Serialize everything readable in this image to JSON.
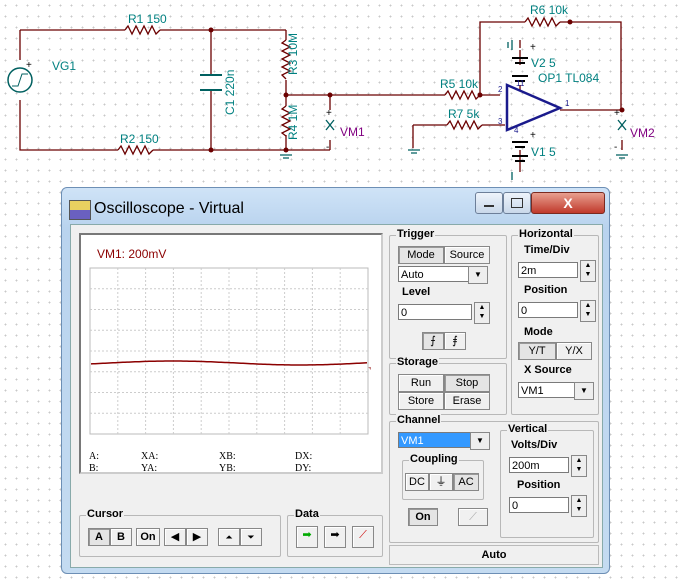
{
  "schematic": {
    "labels": {
      "r1": "R1 150",
      "r2": "R2 150",
      "r3": "R3 10M",
      "r4": "R4 1M",
      "c1": "C1 220n",
      "vg1": "VG1",
      "vm1": "VM1",
      "vm2": "VM2",
      "r5": "R5 10k",
      "r6": "R6 10k",
      "r7": "R7 5k",
      "v2": "V2 5",
      "v1": "V1 5",
      "op1": "OP1 TL084",
      "pin1": "1",
      "pin2": "2",
      "pin3": "3",
      "pin4": "4",
      "pin11": "11",
      "plus": "+",
      "minus": "-"
    }
  },
  "window": {
    "title": "Oscilloscope - Virtual",
    "icon": "oscilloscope-icon"
  },
  "screen": {
    "channel_label": "VM1: 200mV",
    "readouts": {
      "a": "A:",
      "b": "B:",
      "xa": "XA:",
      "ya": "YA:",
      "xb": "XB:",
      "yb": "YB:",
      "dx": "DX:",
      "dy": "DY:"
    },
    "trace_color": "#8b0000"
  },
  "cursor": {
    "title": "Cursor",
    "a": "A",
    "b": "B",
    "on": "On"
  },
  "data_group": {
    "title": "Data"
  },
  "trigger": {
    "title": "Trigger",
    "mode": "Mode",
    "source": "Source",
    "mode_value": "Auto",
    "level_label": "Level",
    "level_value": "0"
  },
  "storage": {
    "title": "Storage",
    "run": "Run",
    "stop": "Stop",
    "store": "Store",
    "erase": "Erase"
  },
  "horizontal": {
    "title": "Horizontal",
    "time_div_label": "Time/Div",
    "time_div_value": "2m",
    "position_label": "Position",
    "position_value": "0",
    "mode_label": "Mode",
    "yt": "Y/T",
    "yx": "Y/X",
    "xsource_label": "X Source",
    "xsource_value": "VM1"
  },
  "channel": {
    "title": "Channel",
    "value": "VM1",
    "coupling_title": "Coupling",
    "dc": "DC",
    "gnd": "⏚",
    "ac": "AC",
    "on": "On"
  },
  "vertical": {
    "title": "Vertical",
    "volts_div_label": "Volts/Div",
    "volts_div_value": "200m",
    "position_label": "Position",
    "position_value": "0"
  },
  "status": {
    "auto": "Auto"
  }
}
